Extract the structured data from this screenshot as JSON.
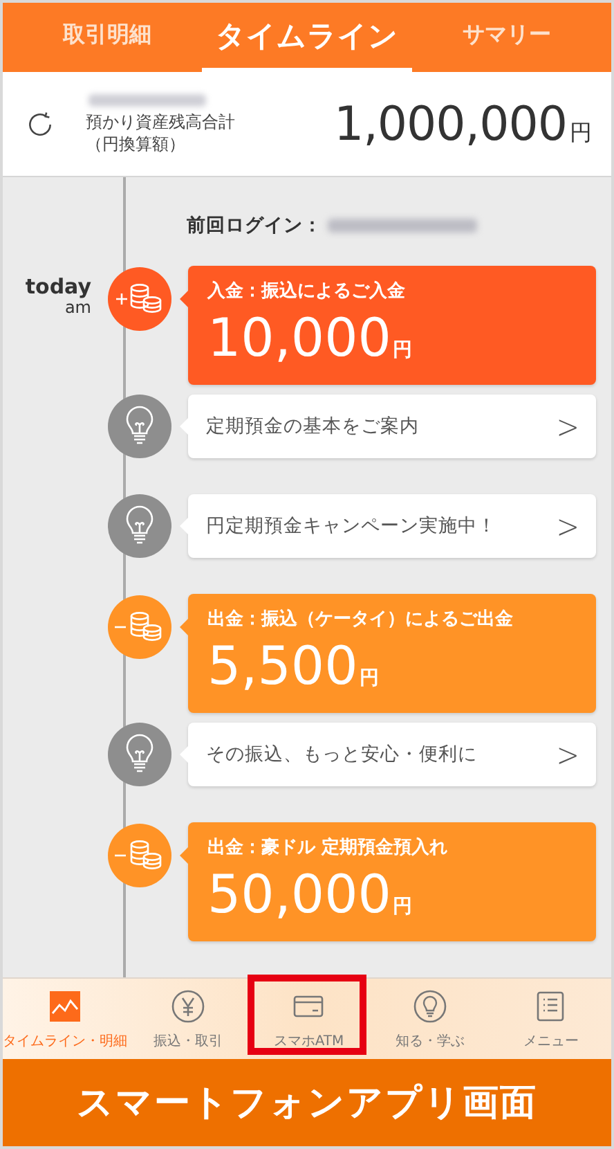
{
  "tabs": [
    {
      "label": "取引明細",
      "selected": false
    },
    {
      "label": "タイムライン",
      "selected": true
    },
    {
      "label": "サマリー",
      "selected": false
    }
  ],
  "balance": {
    "label": "預かり資産残高合計",
    "sublabel": "（円換算額）",
    "amount": "1,000,000",
    "unit": "円"
  },
  "last_login": {
    "label": "前回ログイン："
  },
  "timeline": [
    {
      "kind": "deposit",
      "date": "today",
      "time": "am",
      "title": "入金：振込によるご入金",
      "amount": "10,000",
      "unit": "円",
      "color": "#ff5a23"
    },
    {
      "kind": "info",
      "title": "定期預金の基本をご案内",
      "chevron": ">"
    },
    {
      "kind": "info",
      "title": "円定期預金キャンペーン実施中！",
      "chevron": ">"
    },
    {
      "kind": "withdrawal",
      "title": "出金：振込（ケータイ）によるご出金",
      "amount": "5,500",
      "unit": "円",
      "color": "#ff9326"
    },
    {
      "kind": "info",
      "title": "その振込、もっと安心・便利に",
      "chevron": ">"
    },
    {
      "kind": "withdrawal",
      "title": "出金：豪ドル 定期預金預入れ",
      "amount": "50,000",
      "unit": "円",
      "color": "#ff9326"
    }
  ],
  "bottom_nav": [
    {
      "kind": "chart",
      "label": "タイムライン・明細",
      "selected": true,
      "highlighted": false
    },
    {
      "kind": "yen",
      "label": "振込・取引",
      "selected": false,
      "highlighted": false
    },
    {
      "kind": "card",
      "label": "スマホATM",
      "selected": false,
      "highlighted": true
    },
    {
      "kind": "bulb",
      "label": "知る・学ぶ",
      "selected": false,
      "highlighted": false
    },
    {
      "kind": "list",
      "label": "メニュー",
      "selected": false,
      "highlighted": false
    }
  ],
  "caption": "スマートフォンアプリ画面"
}
